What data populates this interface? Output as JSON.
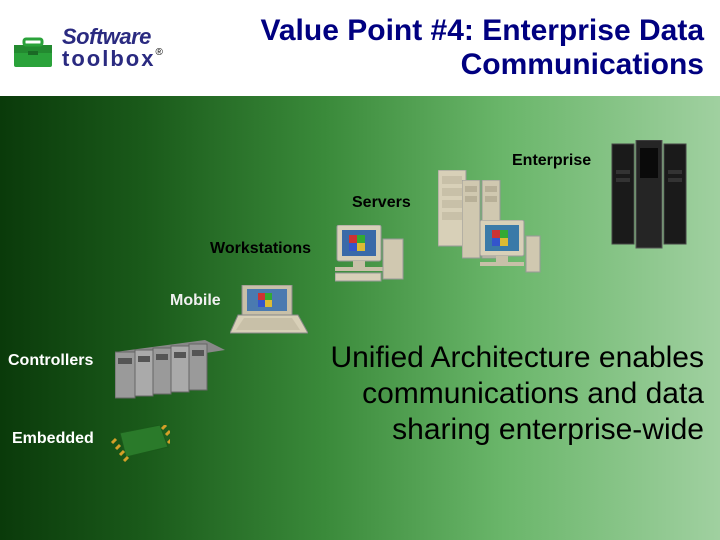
{
  "logo": {
    "line1": "Software",
    "line2": "toolbox",
    "registered": "®"
  },
  "title": "Value Point #4: Enterprise Data Communications",
  "layers": {
    "enterprise": "Enterprise",
    "servers": "Servers",
    "workstations": "Workstations",
    "mobile": "Mobile",
    "controllers": "Controllers",
    "embedded": "Embedded"
  },
  "body": "Unified Architecture enables communications and data sharing enterprise-wide"
}
